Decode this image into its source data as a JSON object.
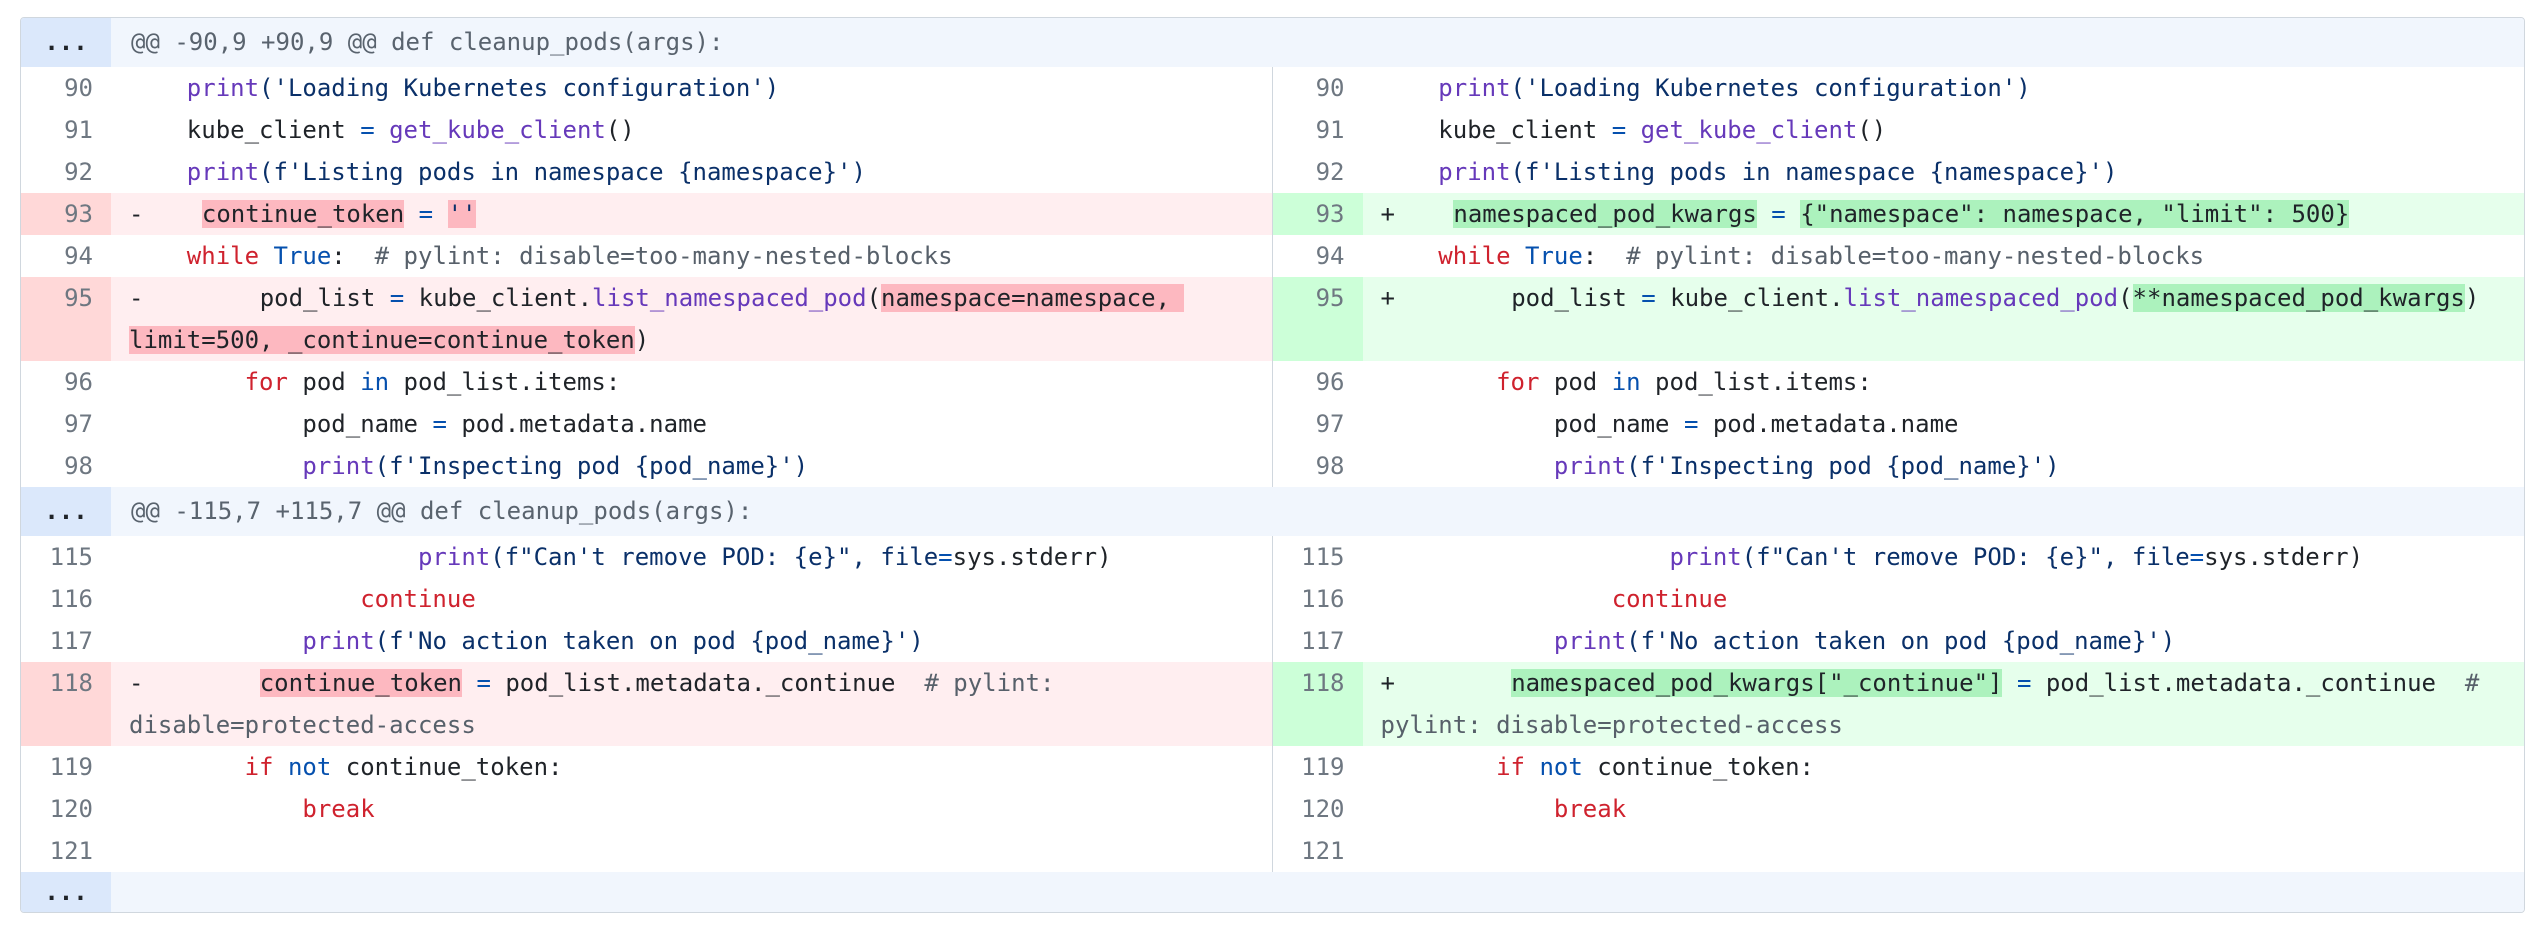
{
  "hunks": [
    {
      "expand": "...",
      "header": "@@ -90,9 +90,9 @@ def cleanup_pods(args):"
    },
    {
      "expand": "...",
      "header": "@@ -115,7 +115,7 @@ def cleanup_pods(args):"
    },
    {
      "expand": "..."
    }
  ],
  "lines": {
    "l90": "90",
    "l91": "91",
    "l92": "92",
    "l93": "93",
    "l94": "94",
    "l95": "95",
    "l96": "96",
    "l97": "97",
    "l98": "98",
    "l115": "115",
    "l116": "116",
    "l117": "117",
    "l118": "118",
    "l119": "119",
    "l120": "120",
    "l121": "121"
  },
  "markers": {
    "minus": "-",
    "plus": "+"
  },
  "code": {
    "print": "print",
    "s_loading": "('Loading Kubernetes configuration')",
    "kube_client": "kube_client",
    "eq": "=",
    "get_kube_client": "get_kube_client",
    "parens": "()",
    "s_listing": "(f'Listing pods in namespace {namespace}')",
    "continue_token": "continue_token",
    "empty_str": "''",
    "while": "while",
    "true": "True",
    "colon": ":",
    "pylint_nested": "  # pylint: disable=too-many-nested-blocks",
    "pod_list": "pod_list",
    "kube_client_dot": "kube_client.",
    "list_ns_pod": "list_namespaced_pod",
    "open_paren": "(",
    "close_paren": ")",
    "old_args_1": "namespace=namespace, ",
    "old_args_2": "limit=500, _continue=continue_token",
    "new_kwargs_line": "namespaced_pod_kwargs",
    "new_kwargs_value": "{\"namespace\": namespace, \"limit\": 500}",
    "new_kwargs_call": "**namespaced_pod_kwargs",
    "for": "for",
    "pod": " pod ",
    "in": "in",
    "pod_list_items": " pod_list.items:",
    "pod_name": "pod_name",
    "pod_metadata_name": "pod.metadata.name",
    "s_inspecting": "(f'Inspecting pod {pod_name}')",
    "s_cant_remove": "(f\"Can't remove POD: {e}\", file",
    "sys_stderr": "sys.stderr)",
    "continue": "continue",
    "s_no_action": "(f'No action taken on pod {pod_name}')",
    "pod_list_meta_continue": " pod_list.metadata._continue",
    "pylint_protected_1": "  # pylint: ",
    "pylint_protected_2": "disable=protected-access",
    "new_kwargs_key": "namespaced_pod_kwargs[\"_continue\"]",
    "pylint_protected_r1": "  # ",
    "pylint_protected_r2": "pylint: disable=protected-access",
    "if": "if",
    "not": "not",
    "continue_token_colon": " continue_token:",
    "break": "break"
  }
}
